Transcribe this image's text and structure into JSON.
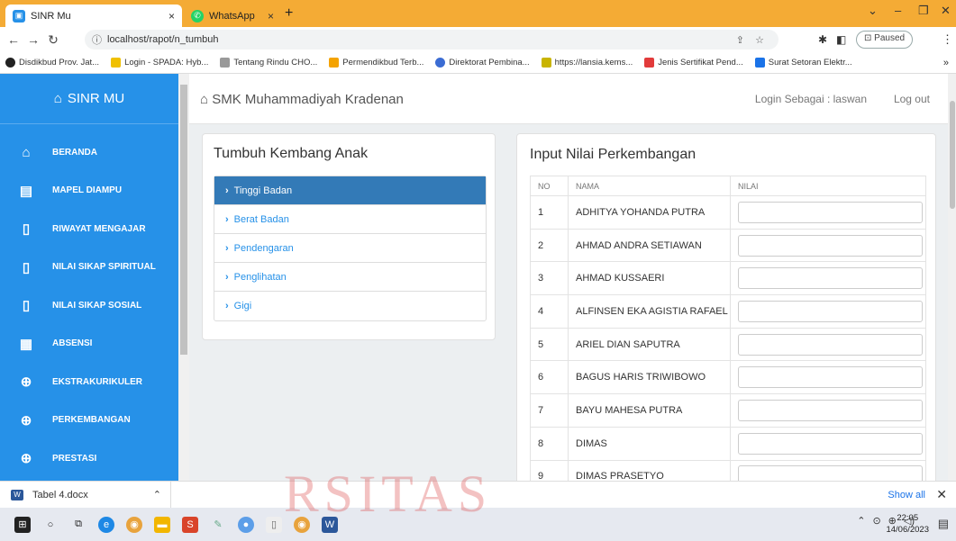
{
  "browser": {
    "tabs": [
      {
        "title": "SINR Mu",
        "active": true
      },
      {
        "title": "WhatsApp",
        "active": false
      }
    ],
    "new_tab": "+",
    "close_glyph": "×",
    "url": "localhost/rapot/n_tumbuh",
    "paused_label": "Paused",
    "bookmarks": [
      "Disdikbud Prov. Jat...",
      "Login - SPADA: Hyb...",
      "Tentang Rindu CHO...",
      "Permendikbud Terb...",
      "Direktorat Pembina...",
      "https://lansia.kems...",
      "Jenis Sertifikat Pend...",
      "Surat Setoran Elektr..."
    ]
  },
  "sidebar": {
    "brand": "SINR MU",
    "items": [
      {
        "label": "BERANDA",
        "icon": "home-icon",
        "glyph": "⌂"
      },
      {
        "label": "MAPEL DIAMPU",
        "icon": "clipboard-icon",
        "glyph": "▤"
      },
      {
        "label": "RIWAYAT MENGAJAR",
        "icon": "file-icon",
        "glyph": "▯"
      },
      {
        "label": "NILAI SIKAP SPIRITUAL",
        "icon": "file-icon",
        "glyph": "▯"
      },
      {
        "label": "NILAI SIKAP SOSIAL",
        "icon": "file-icon",
        "glyph": "▯"
      },
      {
        "label": "ABSENSI",
        "icon": "calendar-icon",
        "glyph": "▦"
      },
      {
        "label": "EKSTRAKURIKULER",
        "icon": "basketball-icon",
        "glyph": "⊕"
      },
      {
        "label": "PERKEMBANGAN",
        "icon": "basketball-icon",
        "glyph": "⊕"
      },
      {
        "label": "PRESTASI",
        "icon": "basketball-icon",
        "glyph": "⊕"
      }
    ]
  },
  "header": {
    "school": "SMK Muhammadiyah Kradenan",
    "login_label": "Login Sebagai : laswan",
    "logout": "Log out"
  },
  "growth_card": {
    "title": "Tumbuh Kembang Anak",
    "items": [
      {
        "label": "Tinggi Badan",
        "active": true
      },
      {
        "label": "Berat Badan",
        "active": false
      },
      {
        "label": "Pendengaran",
        "active": false
      },
      {
        "label": "Penglihatan",
        "active": false
      },
      {
        "label": "Gigi",
        "active": false
      }
    ]
  },
  "input_card": {
    "title": "Input Nilai Perkembangan",
    "columns": [
      "NO",
      "NAMA",
      "NILAI"
    ],
    "rows": [
      {
        "no": "1",
        "nama": "ADHITYA YOHANDA PUTRA",
        "nilai": ""
      },
      {
        "no": "2",
        "nama": "AHMAD ANDRA SETIAWAN",
        "nilai": ""
      },
      {
        "no": "3",
        "nama": "AHMAD KUSSAERI",
        "nilai": ""
      },
      {
        "no": "4",
        "nama": "ALFINSEN EKA AGISTIA RAFAEL",
        "nilai": ""
      },
      {
        "no": "5",
        "nama": "ARIEL DIAN SAPUTRA",
        "nilai": ""
      },
      {
        "no": "6",
        "nama": "BAGUS HARIS TRIWIBOWO",
        "nilai": ""
      },
      {
        "no": "7",
        "nama": "BAYU MAHESA PUTRA",
        "nilai": ""
      },
      {
        "no": "8",
        "nama": "DIMAS",
        "nilai": ""
      },
      {
        "no": "9",
        "nama": "DIMAS PRASETYO",
        "nilai": ""
      }
    ]
  },
  "downloads": {
    "file": "Tabel 4.docx",
    "show_all": "Show all"
  },
  "taskbar": {
    "time": "22:05",
    "date": "14/06/2023"
  },
  "watermark": "RSITAS"
}
